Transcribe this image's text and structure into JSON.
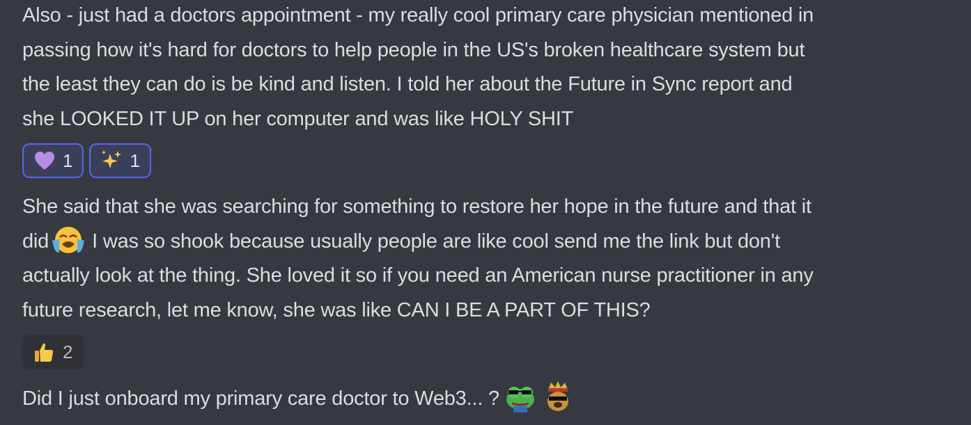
{
  "messages": [
    {
      "lines": [
        "Also - just had a doctors appointment - my really cool primary care physician mentioned in",
        "passing how it's hard for doctors to help people in the US's broken healthcare system but",
        "the least they can do is be kind and listen. I told her about the Future in Sync report and",
        "she LOOKED IT UP on her computer and was like HOLY SHIT"
      ],
      "reactions": [
        {
          "emoji": "purple-heart",
          "count": "1",
          "reacted": true
        },
        {
          "emoji": "sparkles",
          "count": "1",
          "reacted": true
        }
      ]
    },
    {
      "lines": [
        "She said that she was searching for something to restore her hope in the future and that it",
        "did",
        "I was so shook because usually people are like cool send me the link but don't",
        "actually look at the thing. She loved it so if you need an American nurse practitioner in any",
        "future research, let me know, she was like CAN I BE A PART OF THIS?"
      ],
      "inline_emoji": "loudly-crying-face",
      "reactions": [
        {
          "emoji": "thumbs-up",
          "count": "2",
          "reacted": false
        }
      ]
    },
    {
      "lines": [
        "Did I just onboard my primary care doctor to Web3... ?"
      ],
      "trailing_emojis": [
        "pepe-frog-emoji",
        "king-doge-emoji"
      ]
    }
  ],
  "colors": {
    "background": "#36393f",
    "text": "#dcddde",
    "reaction_active_bg": "#3b405a",
    "reaction_active_border": "#5865f2",
    "reaction_bg": "#2f3136"
  }
}
